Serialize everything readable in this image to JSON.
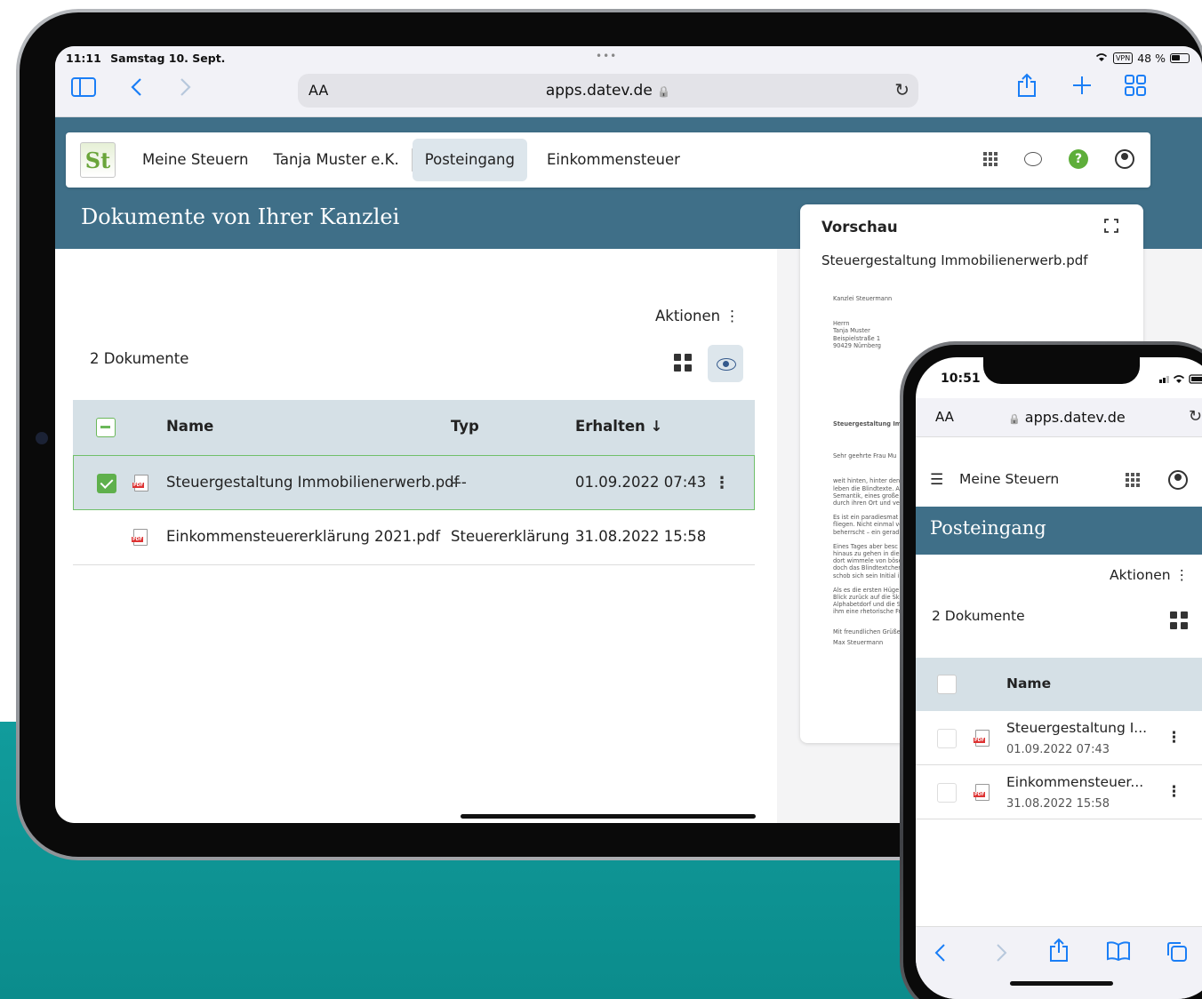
{
  "tablet": {
    "status": {
      "time": "11:11",
      "date": "Samstag 10. Sept.",
      "vpn": "VPN",
      "battery": "48 %"
    },
    "safari": {
      "text_size": "AA",
      "url": "apps.datev.de",
      "lock": "🔒",
      "reload": "↻"
    },
    "nav": {
      "logo_text": "St",
      "items": [
        "Meine Steuern",
        "Tanja Muster e.K.",
        "Posteingang",
        "Einkommensteuer"
      ],
      "help": "?"
    },
    "page_title": "Dokumente von Ihrer Kanzlei",
    "aktionen": "Aktionen ⋮",
    "doc_count": "2 Dokumente",
    "table": {
      "headers": {
        "name": "Name",
        "typ": "Typ",
        "erhalten": "Erhalten ↓"
      },
      "rows": [
        {
          "name": "Steuergestaltung Immobilienerwerb.pdf",
          "typ": "---",
          "date": "01.09.2022 07:43",
          "selected": true
        },
        {
          "name": "Einkommensteuererklärung 2021.pdf",
          "typ": "Steuererklärung",
          "date": "31.08.2022 15:58",
          "selected": false
        }
      ],
      "kebab": "⋮"
    },
    "preview": {
      "title": "Vorschau",
      "expand": "⛶",
      "filename": "Steuergestaltung Immobilienerwerb.pdf",
      "doc": {
        "sender": "Kanzlei Steuermann",
        "address": [
          "Herrn",
          "Tanja Muster",
          "Beispielstraße 1",
          "90429 Nürnberg"
        ],
        "subject": "Steuergestaltung Imm",
        "salutation": "Sehr geehrte Frau Mu",
        "paragraphs": [
          [
            "weit hinten, hinter den",
            "leben die Blindtexte. A",
            "Semantik, eines große",
            "durch ihren Ort und ve"
          ],
          [
            "Es ist ein paradiesmat",
            "fliegen. Nicht einmal vo",
            "beherrscht – ein gerad"
          ],
          [
            "Eines Tages aber besc",
            "hinaus zu gehen in die",
            "dort wimmele von böse",
            "doch das Blindtextcher",
            "schob sich sein Initial i"
          ],
          [
            "Als es die ersten Hüge",
            "Blick zurück auf die Sk",
            "Alphabetdorf und die S",
            "ihm eine rhetorische Fr"
          ]
        ],
        "closing": "Mit freundlichen Grüße",
        "signature": "Max Steuermann"
      }
    }
  },
  "phone": {
    "status": {
      "time": "10:51"
    },
    "safari": {
      "text_size": "AA",
      "url": "apps.datev.de",
      "lock": "🔒",
      "reload": "↻"
    },
    "nav": {
      "menu": "☰",
      "title": "Meine Steuern"
    },
    "page_title": "Posteingang",
    "aktionen": "Aktionen ⋮",
    "doc_count": "2 Dokumente",
    "table": {
      "header_name": "Name",
      "rows": [
        {
          "name": "Steuergestaltung I...",
          "date": "01.09.2022 07:43"
        },
        {
          "name": "Einkommensteuer...",
          "date": "31.08.2022 15:58"
        }
      ],
      "kebab": "⋮"
    },
    "toolbar": {
      "back": "‹",
      "forward": "›",
      "share": "⇪",
      "bookmarks": "📖",
      "tabs": "⧉"
    }
  }
}
